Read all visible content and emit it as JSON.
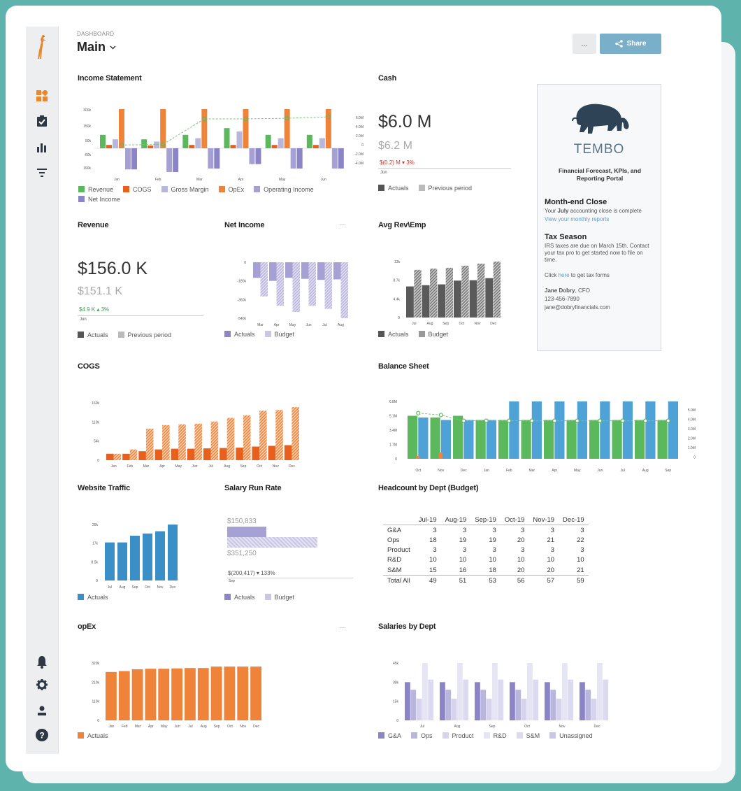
{
  "header": {
    "crumb": "DASHBOARD",
    "title": "Main",
    "more": "...",
    "share": "Share"
  },
  "sidebar": {
    "icons": [
      "giraffe-logo-icon",
      "dashboard-icon",
      "clipboard-check-icon",
      "bar-chart-icon",
      "filter-icon",
      "bell-icon",
      "gear-icon",
      "user-icon",
      "help-icon"
    ]
  },
  "widgets": {
    "income": {
      "title": "Income Statement"
    },
    "cash": {
      "title": "Cash",
      "value": "$6.0 M",
      "prev": "$6.2 M",
      "delta": "$(0.2) M",
      "delta_pct": "3%",
      "axis": "Jun",
      "leg_a": "Actuals",
      "leg_b": "Previous period"
    },
    "tembo": {
      "brand": "TEMBO",
      "subtitle": "Financial Forecast, KPIs, and Reporting Portal",
      "h1": "Month-end Close",
      "p1a": "Your ",
      "p1b": "July",
      "p1c": " accounting close is complete",
      "link1": "View your monthly reports",
      "h2": "Tax Season",
      "p2": "IRS taxes are due on March 15th. Contact your tax pro to get started now to file on time.",
      "p3a": "Click ",
      "p3b": "here",
      "p3c": " to get tax forms",
      "sig_name": "Jane Dobry",
      "sig_role": ", CFO",
      "sig_phone": "123-456-7890",
      "sig_email": "jane@dobryfinancials.com"
    },
    "revenue": {
      "title": "Revenue",
      "value": "$156.0 K",
      "prev": "$151.1 K",
      "delta": "$4.9 K",
      "delta_pct": "3%",
      "axis": "Jun",
      "leg_a": "Actuals",
      "leg_b": "Previous period"
    },
    "netincome": {
      "title": "Net Income",
      "more": "...",
      "leg_a": "Actuals",
      "leg_b": "Budget"
    },
    "avgrev": {
      "title": "Avg Rev\\Emp",
      "leg_a": "Actuals",
      "leg_b": "Budget"
    },
    "cogs": {
      "title": "COGS"
    },
    "balance": {
      "title": "Balance Sheet"
    },
    "traffic": {
      "title": "Website Traffic",
      "leg_a": "Actuals"
    },
    "salary": {
      "title": "Salary Run Rate",
      "v1": "$150,833",
      "v2": "$351,250",
      "delta": "$(200,417)",
      "delta_pct": "133%",
      "axis": "Sep",
      "leg_a": "Actuals",
      "leg_b": "Budget"
    },
    "headcount": {
      "title": "Headcount by Dept (Budget)"
    },
    "opex": {
      "title": "opEx",
      "more": "...",
      "leg_a": "Actuals"
    },
    "salaries": {
      "title": "Salaries by Dept"
    }
  },
  "headcount_table": {
    "columns": [
      "",
      "Jul-19",
      "Aug-19",
      "Sep-19",
      "Oct-19",
      "Nov-19",
      "Dec-19"
    ],
    "rows": [
      [
        "G&A",
        "3",
        "3",
        "3",
        "3",
        "3",
        "3"
      ],
      [
        "Ops",
        "18",
        "19",
        "19",
        "20",
        "21",
        "22"
      ],
      [
        "Product",
        "3",
        "3",
        "3",
        "3",
        "3",
        "3"
      ],
      [
        "R&D",
        "10",
        "10",
        "10",
        "10",
        "10",
        "10"
      ],
      [
        "S&M",
        "15",
        "16",
        "18",
        "20",
        "20",
        "21"
      ],
      [
        "Total All",
        "49",
        "51",
        "53",
        "56",
        "57",
        "59"
      ]
    ]
  },
  "colors": {
    "green": "#5cb85c",
    "orange": "#f0833a",
    "darkorange": "#e8601c",
    "lav": "#b9b6dc",
    "purple": "#8b85c8",
    "blue": "#3a8fc7",
    "gray": "#5a5a5a",
    "lightgray": "#bbb"
  },
  "chart_data": [
    {
      "id": "income",
      "type": "bar",
      "title": "Income Statement",
      "categories": [
        "Jan",
        "Feb",
        "Mar",
        "Apr",
        "May",
        "Jun"
      ],
      "yticks": [
        "300k",
        "150k",
        "50k",
        "-60k",
        "190k"
      ],
      "y2ticks": [
        "6.0M",
        "4.0M",
        "2.0M",
        "0",
        "-2.0M",
        "-4.0M"
      ],
      "series": [
        {
          "name": "Revenue",
          "values": [
            60,
            40,
            60,
            90,
            60,
            60
          ]
        },
        {
          "name": "COGS",
          "values": [
            15,
            12,
            15,
            15,
            15,
            15
          ]
        },
        {
          "name": "Gross Margin",
          "values": [
            40,
            30,
            45,
            75,
            45,
            45
          ]
        },
        {
          "name": "OpEx",
          "values": [
            175,
            175,
            175,
            175,
            175,
            175
          ]
        },
        {
          "name": "Operating Income",
          "values": [
            -120,
            -135,
            -115,
            -90,
            -115,
            -115
          ]
        },
        {
          "name": "Net Income",
          "values": [
            -120,
            -135,
            -115,
            -90,
            -115,
            -115
          ]
        }
      ],
      "line": [
        0.5,
        0.6,
        4.5,
        4.5,
        4.6,
        4.8
      ]
    },
    {
      "id": "cash",
      "type": "bar",
      "categories": [
        "Jun"
      ]
    },
    {
      "id": "revenue",
      "type": "bar",
      "categories": [
        "Jun"
      ]
    },
    {
      "id": "netincome",
      "type": "bar",
      "categories": [
        "Mar",
        "Apr",
        "May",
        "Jun",
        "Jul",
        "Aug"
      ],
      "yticks": [
        "0",
        "-180k",
        "-360k",
        "-540k"
      ],
      "series": [
        {
          "name": "Actuals",
          "values": [
            -150,
            -180,
            -150,
            -160,
            -170,
            -165
          ]
        },
        {
          "name": "Budget",
          "values": [
            -330,
            -420,
            -480,
            -420,
            -450,
            -540
          ]
        }
      ]
    },
    {
      "id": "avgrev",
      "type": "bar",
      "categories": [
        "Jul",
        "Aug",
        "Sep",
        "Oct",
        "Nov",
        "Dec"
      ],
      "yticks": [
        "13k",
        "8.7k",
        "4.4k",
        "0"
      ],
      "series": [
        {
          "name": "Actuals",
          "values": [
            7.5,
            7.8,
            8.0,
            8.9,
            9.0,
            9.5
          ]
        },
        {
          "name": "Budget",
          "values": [
            11.5,
            11.8,
            12.0,
            12.5,
            13.0,
            13.5
          ]
        }
      ]
    },
    {
      "id": "cogs",
      "type": "bar",
      "categories": [
        "Jan",
        "Feb",
        "Mar",
        "Apr",
        "May",
        "Jun",
        "Jul",
        "Aug",
        "Sep",
        "Oct",
        "Nov",
        "Dec"
      ],
      "yticks": [
        "160k",
        "110k",
        "54k",
        "0"
      ],
      "series": [
        {
          "name": "Actuals",
          "values": [
            18,
            18,
            25,
            30,
            32,
            32,
            33,
            34,
            35,
            38,
            40,
            42
          ]
        },
        {
          "name": "Budget",
          "values": [
            18,
            30,
            88,
            98,
            100,
            102,
            108,
            118,
            125,
            138,
            140,
            148
          ]
        }
      ]
    },
    {
      "id": "balance",
      "type": "bar",
      "categories": [
        "Oct",
        "Nov",
        "Dec",
        "Jan",
        "Feb",
        "Mar",
        "Apr",
        "May",
        "Jun",
        "Jul",
        "Aug",
        "Sep"
      ],
      "yticks": [
        "6.8M",
        "5.1M",
        "3.4M",
        "1.7M",
        "0"
      ],
      "y2ticks": [
        "5.0M",
        "4.0M",
        "3.0M",
        "2.0M",
        "1.0M",
        "0"
      ],
      "series": [
        {
          "name": "Green",
          "values": [
            5.1,
            4.9,
            5.1,
            4.6,
            4.6,
            4.6,
            4.6,
            4.6,
            4.6,
            4.6,
            4.6,
            4.6,
            4.6,
            4.6,
            4.6,
            4.6,
            4.6,
            4.6,
            4.6,
            4.6,
            4.6,
            4.6,
            4.6,
            4.6
          ]
        },
        {
          "name": "Blue",
          "values": [
            4.9,
            4.6,
            4.6,
            4.6,
            6.8,
            6.8,
            6.8,
            6.8,
            6.8,
            6.8,
            6.8,
            6.8,
            6.8,
            6.8,
            6.8,
            6.8,
            6.8,
            6.8,
            6.8,
            6.8,
            6.8,
            6.8,
            6.8,
            6.8
          ]
        }
      ],
      "line": [
        4.8,
        4.6,
        4.0,
        4.0,
        4.0,
        4.0,
        4.0,
        4.0,
        4.0,
        4.0,
        4.0,
        4.0
      ]
    },
    {
      "id": "traffic",
      "type": "bar",
      "categories": [
        "Jul",
        "Aug",
        "Sep",
        "Oct",
        "Nov",
        "Dec"
      ],
      "yticks": [
        "25k",
        "17k",
        "8.5k",
        "0"
      ],
      "series": [
        {
          "name": "Actuals",
          "values": [
            17,
            17,
            20,
            21,
            22,
            25
          ]
        }
      ]
    },
    {
      "id": "opex",
      "type": "bar",
      "categories": [
        "Jan",
        "Feb",
        "Mar",
        "Apr",
        "May",
        "Jun",
        "Jul",
        "Aug",
        "Sep",
        "Oct",
        "Nov",
        "Dec"
      ],
      "yticks": [
        "320k",
        "210k",
        "110k",
        "0"
      ],
      "series": [
        {
          "name": "Actuals",
          "values": [
            270,
            275,
            285,
            288,
            288,
            290,
            292,
            292,
            300,
            300,
            300,
            300
          ]
        }
      ]
    },
    {
      "id": "salaries",
      "type": "bar",
      "categories": [
        "Jul",
        "Aug",
        "Sep",
        "Oct",
        "Nov",
        "Dec"
      ],
      "yticks": [
        "45k",
        "30k",
        "15k",
        "0"
      ],
      "series": [
        {
          "name": "G&A",
          "values": [
            30,
            30,
            30,
            30,
            30,
            30
          ]
        },
        {
          "name": "Ops",
          "values": [
            24,
            24,
            24,
            24,
            24,
            24
          ]
        },
        {
          "name": "Product",
          "values": [
            17,
            17,
            17,
            17,
            17,
            17
          ]
        },
        {
          "name": "R&D",
          "values": [
            45,
            45,
            45,
            45,
            45,
            45
          ]
        },
        {
          "name": "S&M",
          "values": [
            32,
            32,
            32,
            32,
            32,
            32
          ]
        },
        {
          "name": "Unassigned",
          "values": [
            0,
            0,
            0,
            0,
            0,
            0
          ]
        }
      ]
    }
  ]
}
